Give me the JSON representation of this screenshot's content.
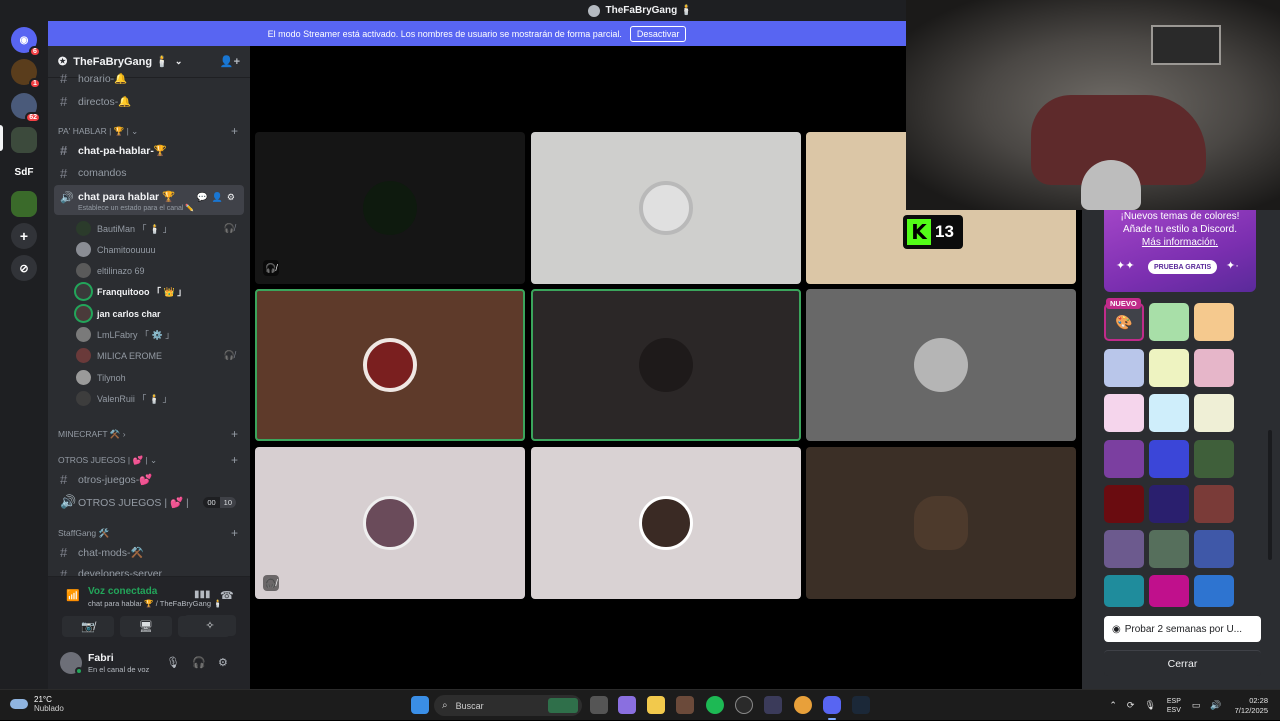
{
  "window": {
    "title": "TheFaBryGang 🕯️"
  },
  "rail": {
    "badges": [
      "6",
      "1",
      "62"
    ],
    "folder_label": "SdF"
  },
  "banner": {
    "text": "El modo Streamer está activado. Los nombres de usuario se mostrarán de forma parcial.",
    "button": "Desactivar"
  },
  "server": {
    "name": "TheFaBryGang 🕯️"
  },
  "channels": {
    "top": [
      "horario-🔔",
      "directos-🔔"
    ],
    "cat_pa_hablar": "PA' HABLAR | 🏆 |",
    "pa_hablar_channels": [
      "chat-pa-hablar-🏆",
      "comandos"
    ],
    "voice_channel": {
      "name": "chat para hablar 🏆",
      "status_hint": "Establece un estado para el canal ✏️"
    },
    "members": [
      {
        "name": "BautiMan 「 🕯️ 」",
        "muted": true,
        "speaking": false
      },
      {
        "name": "Chamitoouuuu",
        "muted": false,
        "speaking": false
      },
      {
        "name": "eltilinazo 69",
        "muted": false,
        "speaking": false
      },
      {
        "name": "Franquitooo 「 👑 」",
        "muted": false,
        "speaking": true
      },
      {
        "name": "jan carlos char",
        "muted": false,
        "speaking": true
      },
      {
        "name": "LmLFabry 「 ⚙️ 」",
        "muted": false,
        "speaking": false
      },
      {
        "name": "MILICA EROME",
        "muted": true,
        "speaking": false
      },
      {
        "name": "Tilynoh",
        "muted": false,
        "speaking": false
      },
      {
        "name": "ValenRuii 「 🕯️ 」",
        "muted": false,
        "speaking": false
      }
    ],
    "cat_minecraft": "MINECRAFT ⚒️",
    "cat_otros": "OTROS JUEGOS | 💕 |",
    "otros_text": "otros-juegos-💕",
    "otros_voice": "OTROS JUEGOS | 💕 |",
    "otros_counts": [
      "00",
      "10"
    ],
    "cat_staff": "StaffGang 🛠️",
    "staff_channels": [
      "chat-mods-⚒️",
      "developers-server"
    ]
  },
  "voice_panel": {
    "title": "Voz conectada",
    "subtitle": "chat para hablar 🏆 / TheFaBryGang 🕯️"
  },
  "user": {
    "name": "Fabri",
    "status": "En el canal de voz"
  },
  "kick_overlay": {
    "number": "13"
  },
  "theme_panel": {
    "promo_line1": "¡Nuevos temas de colores!",
    "promo_line2": "Añade tu estilo a Discord.",
    "promo_link": "Más información.",
    "promo_button": "PRUEBA GRATIS",
    "new_badge": "NUEVO",
    "trial_button": "Probar 2 semanas por U...",
    "close_button": "Cerrar",
    "swatch_colors": [
      "#a8dfa8",
      "#f5c98e",
      "#b9c6ea",
      "#eef3c1",
      "#e6b6c9",
      "#f5d5ec",
      "#cfeefb",
      "#efefd6",
      "#7b3fa0",
      "#3b46d8",
      "#3f5f3a",
      "#6a0c10",
      "#2a1f6e",
      "#7a3b38",
      "#6c5a8e",
      "#566f5c",
      "#3f58a8",
      "#1f8c9c",
      "#c0108c",
      "#2e74d0"
    ]
  },
  "taskbar": {
    "temp": "21°C",
    "weather": "Nublado",
    "search_placeholder": "Buscar",
    "lang1": "ESP",
    "lang2": "ESV",
    "time": "02:28",
    "date": "7/12/2025"
  }
}
